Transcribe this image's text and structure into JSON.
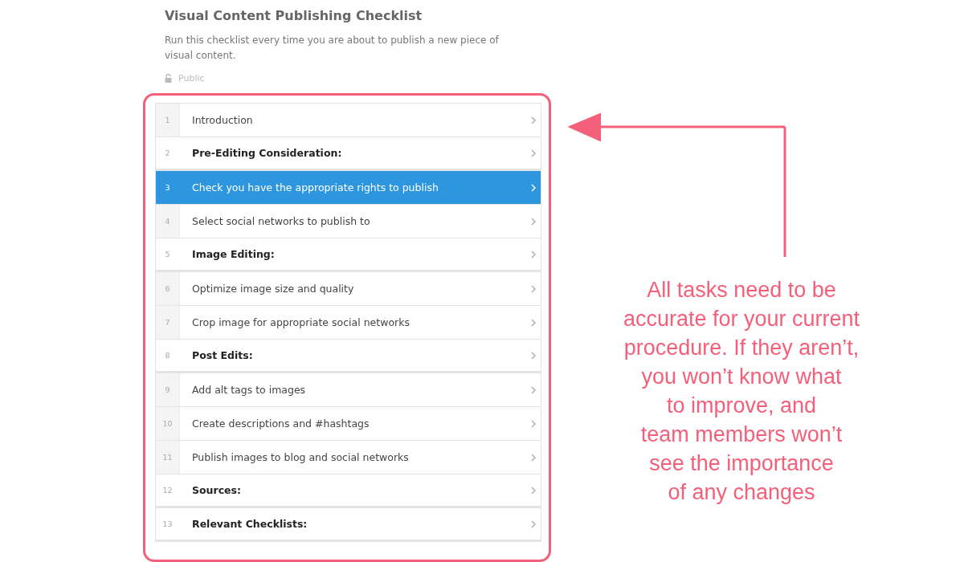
{
  "checklist": {
    "title": "Visual Content Publishing Checklist",
    "description": "Run this checklist every time you are about to publish a new piece of visual content.",
    "visibility": "Public"
  },
  "tasks": [
    {
      "number": "1",
      "label": "Introduction",
      "kind": "task",
      "selected": false
    },
    {
      "number": "2",
      "label": "Pre-Editing Consideration:",
      "kind": "heading",
      "selected": false
    },
    {
      "number": "3",
      "label": "Check you have the appropriate rights to publish",
      "kind": "task",
      "selected": true
    },
    {
      "number": "4",
      "label": "Select social networks to publish to",
      "kind": "task",
      "selected": false
    },
    {
      "number": "5",
      "label": "Image Editing:",
      "kind": "heading",
      "selected": false
    },
    {
      "number": "6",
      "label": "Optimize image size and quality",
      "kind": "task",
      "selected": false
    },
    {
      "number": "7",
      "label": "Crop image for appropriate social networks",
      "kind": "task",
      "selected": false
    },
    {
      "number": "8",
      "label": "Post Edits:",
      "kind": "heading",
      "selected": false
    },
    {
      "number": "9",
      "label": "Add alt tags to images",
      "kind": "task",
      "selected": false
    },
    {
      "number": "10",
      "label": "Create descriptions and #hashtags",
      "kind": "task",
      "selected": false
    },
    {
      "number": "11",
      "label": "Publish images to blog and social networks",
      "kind": "task",
      "selected": false
    },
    {
      "number": "12",
      "label": "Sources:",
      "kind": "heading",
      "selected": false
    },
    {
      "number": "13",
      "label": "Relevant Checklists:",
      "kind": "heading",
      "selected": false
    }
  ],
  "annotation": {
    "lines": [
      "All tasks need to be",
      "accurate for your current",
      "procedure. If they aren’t,",
      "you won’t know what",
      "to improve, and",
      "team members won’t",
      "see the importance",
      "of any changes"
    ]
  }
}
